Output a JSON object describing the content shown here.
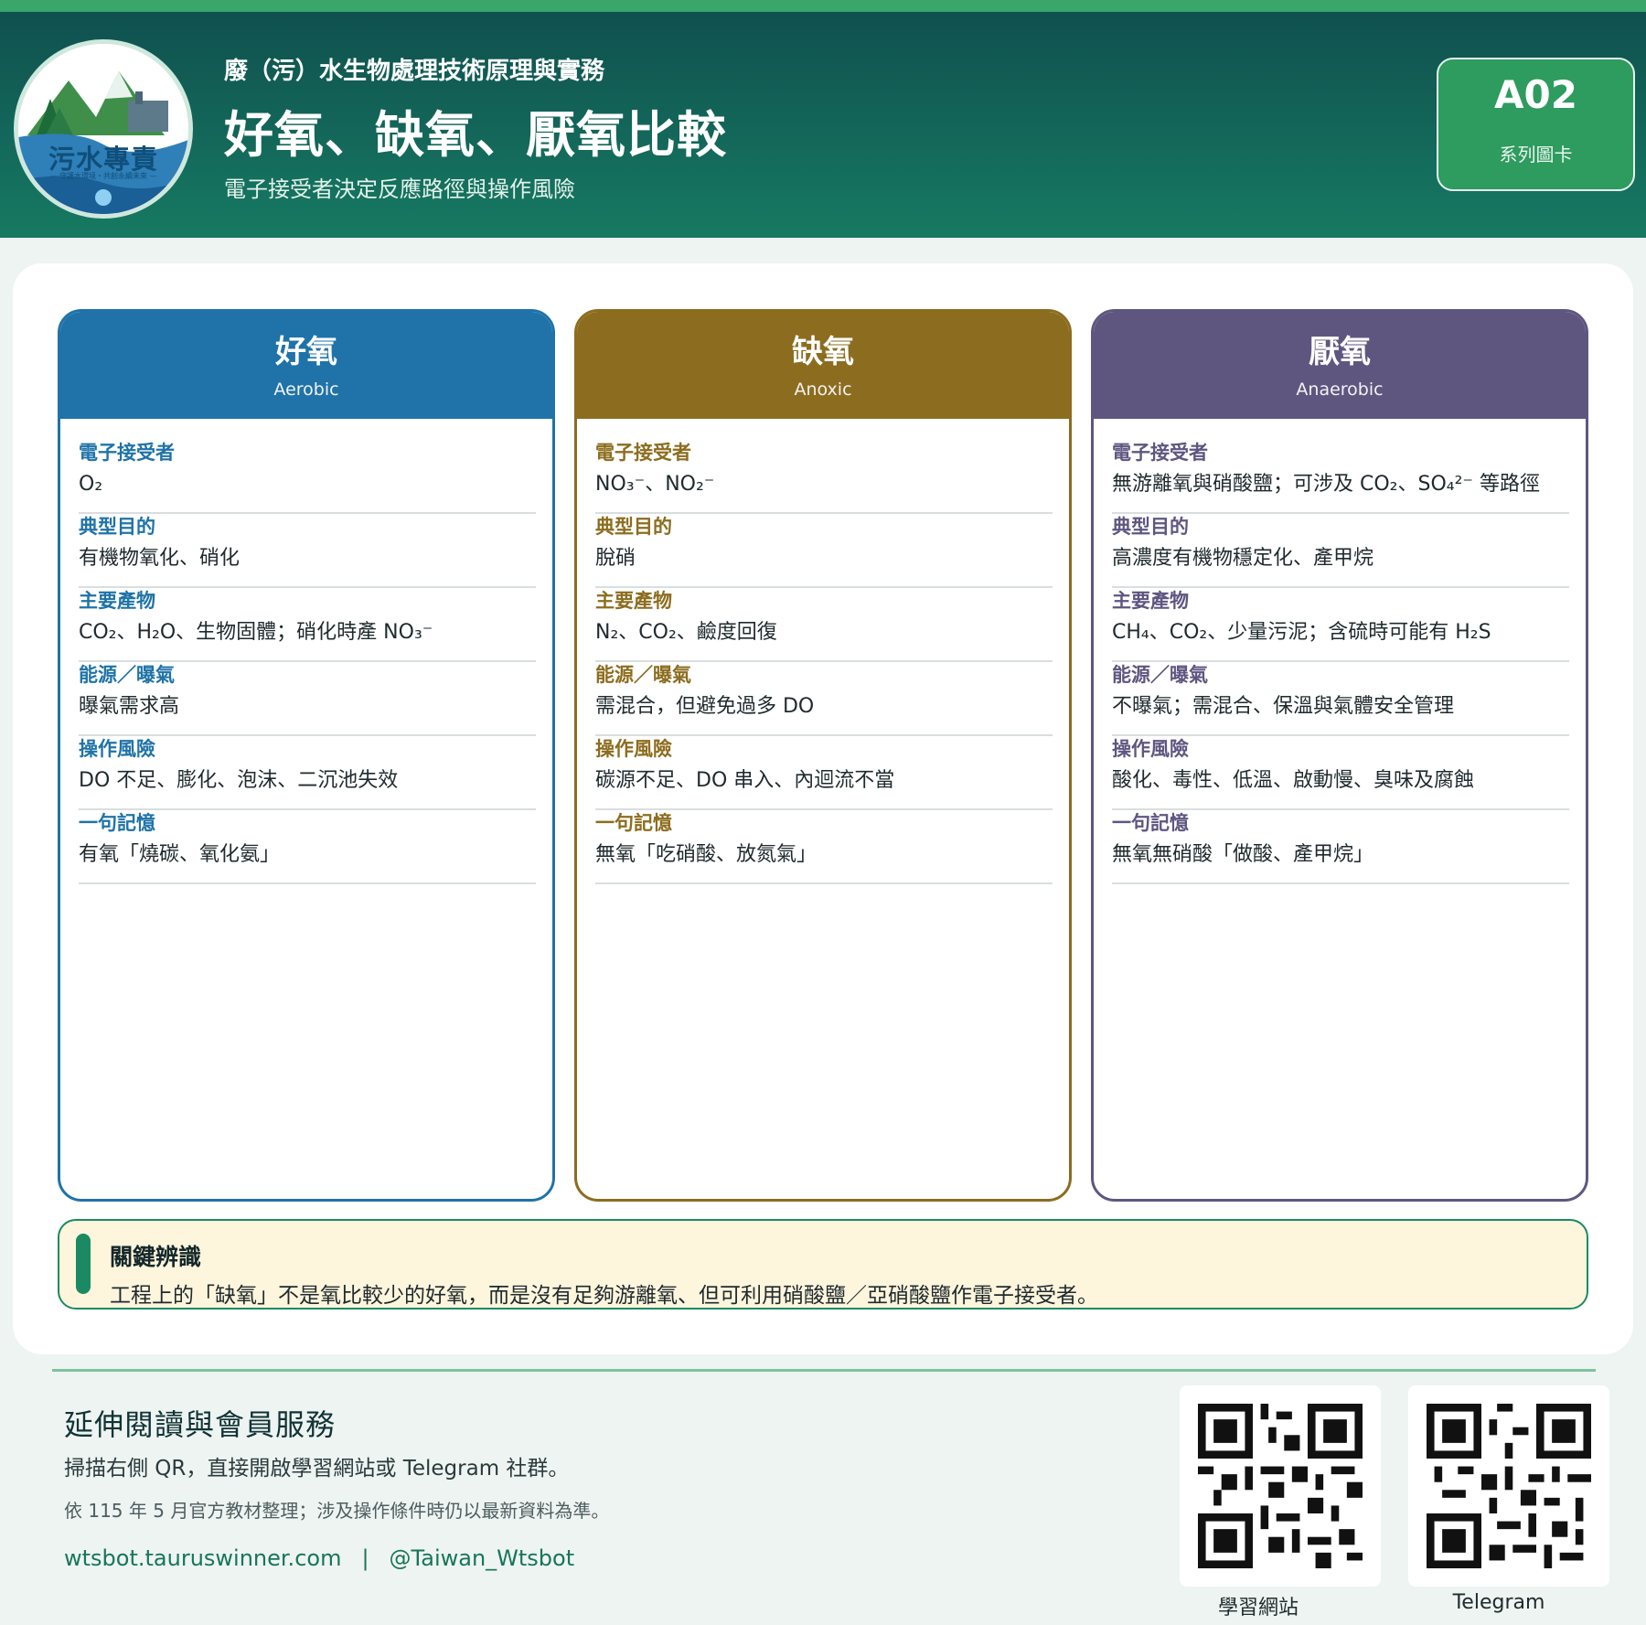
{
  "header": {
    "logo_text": "污水專責",
    "logo_sub": "— 守護水環境・共創永續未來 —",
    "series_title": "廢（污）水生物處理技術原理與實務",
    "main_title": "好氧、缺氧、厭氧比較",
    "subtitle": "電子接受者決定反應路徑與操作風險",
    "badge_code": "A02",
    "badge_label": "系列圖卡"
  },
  "columns": [
    {
      "name": "好氧",
      "en": "Aerobic",
      "color": "#1f73a8",
      "rows": [
        {
          "label": "電子接受者",
          "value": "O₂"
        },
        {
          "label": "典型目的",
          "value": "有機物氧化、硝化"
        },
        {
          "label": "主要產物",
          "value": "CO₂、H₂O、生物固體；硝化時產 NO₃⁻"
        },
        {
          "label": "能源／曝氣",
          "value": "曝氣需求高"
        },
        {
          "label": "操作風險",
          "value": "DO 不足、膨化、泡沫、二沉池失效"
        },
        {
          "label": "一句記憶",
          "value": "有氧「燒碳、氧化氨」"
        }
      ]
    },
    {
      "name": "缺氧",
      "en": "Anoxic",
      "color": "#8c6d1f",
      "rows": [
        {
          "label": "電子接受者",
          "value": "NO₃⁻、NO₂⁻"
        },
        {
          "label": "典型目的",
          "value": "脫硝"
        },
        {
          "label": "主要產物",
          "value": "N₂、CO₂、鹼度回復"
        },
        {
          "label": "能源／曝氣",
          "value": "需混合，但避免過多 DO"
        },
        {
          "label": "操作風險",
          "value": "碳源不足、DO 串入、內迴流不當"
        },
        {
          "label": "一句記憶",
          "value": "無氧「吃硝酸、放氮氣」"
        }
      ]
    },
    {
      "name": "厭氧",
      "en": "Anaerobic",
      "color": "#5f5680",
      "rows": [
        {
          "label": "電子接受者",
          "value": "無游離氧與硝酸鹽；可涉及 CO₂、SO₄²⁻ 等路徑"
        },
        {
          "label": "典型目的",
          "value": "高濃度有機物穩定化、產甲烷"
        },
        {
          "label": "主要產物",
          "value": "CH₄、CO₂、少量污泥；含硫時可能有 H₂S"
        },
        {
          "label": "能源／曝氣",
          "value": "不曝氣；需混合、保溫與氣體安全管理"
        },
        {
          "label": "操作風險",
          "value": "酸化、毒性、低溫、啟動慢、臭味及腐蝕"
        },
        {
          "label": "一句記憶",
          "value": "無氧無硝酸「做酸、產甲烷」"
        }
      ]
    }
  ],
  "key_point": {
    "title": "關鍵辨識",
    "text": "工程上的「缺氧」不是氧比較少的好氧，而是沒有足夠游離氧、但可利用硝酸鹽／亞硝酸鹽作電子接受者。"
  },
  "footer": {
    "title": "延伸閱讀與會員服務",
    "desc": "掃描右側 QR，直接開啟學習網站或 Telegram 社群。",
    "note": "依 115 年 5 月官方教材整理；涉及操作條件時仍以最新資料為準。",
    "site": "wtsbot.tauruswinner.com",
    "separator": "|",
    "telegram": "@Taiwan_Wtsbot",
    "qr_labels": [
      "學習網站",
      "Telegram"
    ]
  }
}
